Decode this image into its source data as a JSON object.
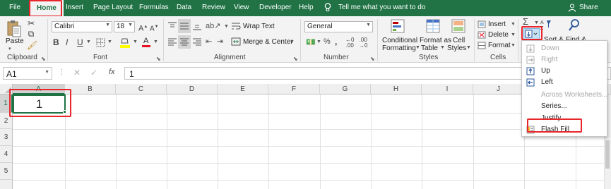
{
  "tabs": [
    "File",
    "Home",
    "Insert",
    "Page Layout",
    "Formulas",
    "Data",
    "Review",
    "View",
    "Developer",
    "Help"
  ],
  "tell_me": "Tell me what you want to do",
  "share": "Share",
  "clipboard": {
    "paste": "Paste",
    "label": "Clipboard"
  },
  "font": {
    "name": "Calibri",
    "size": "18",
    "label": "Font"
  },
  "alignment": {
    "wrap": "Wrap Text",
    "merge": "Merge & Center",
    "label": "Alignment"
  },
  "number": {
    "format": "General",
    "label": "Number"
  },
  "styles": {
    "conditional_1": "Conditional",
    "conditional_2": "Formatting",
    "table_1": "Format as",
    "table_2": "Table",
    "cell_1": "Cell",
    "cell_2": "Styles",
    "label": "Styles"
  },
  "cells": {
    "insert": "Insert",
    "delete": "Delete",
    "format": "Format",
    "label": "Cells"
  },
  "editing": {
    "sort": "Sort &",
    "find": "Find &"
  },
  "formula_bar": {
    "name_box": "A1",
    "fx": "fx",
    "value": "1"
  },
  "columns": [
    "A",
    "B",
    "C",
    "D",
    "E",
    "F",
    "G",
    "H",
    "I",
    "J"
  ],
  "rows": [
    "1",
    "2",
    "3",
    "4",
    "5"
  ],
  "cell_a1": "1",
  "fill_menu": {
    "items": [
      {
        "label": "Down",
        "enabled": false
      },
      {
        "label": "Right",
        "enabled": false
      },
      {
        "label": "Up",
        "enabled": true
      },
      {
        "label": "Left",
        "enabled": true
      },
      {
        "label": "Across Worksheets...",
        "enabled": false
      },
      {
        "label": "Series...",
        "enabled": true
      },
      {
        "label": "Justify",
        "enabled": true
      },
      {
        "label": "Flash Fill",
        "enabled": true
      }
    ]
  },
  "colors": {
    "excel_green": "#217346",
    "highlight_red": "#e8262c",
    "font_red": "#e81123",
    "fill_yellow": "#ffff00"
  }
}
